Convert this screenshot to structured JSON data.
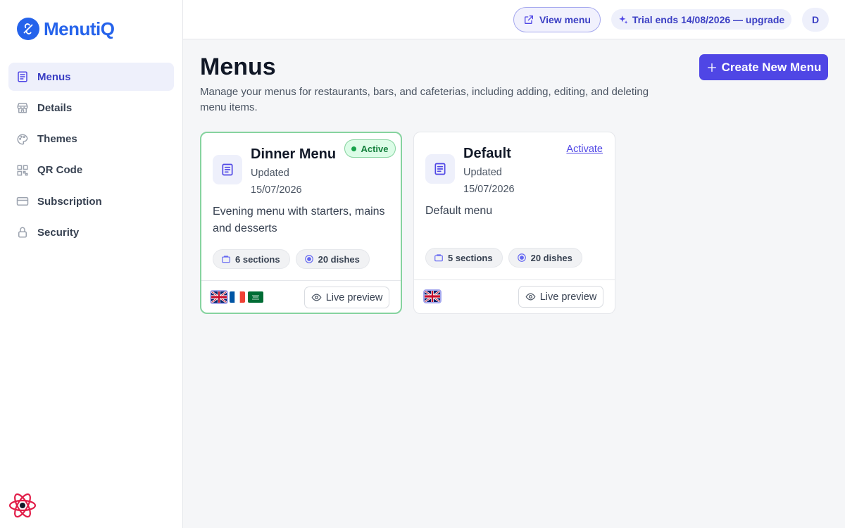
{
  "app": {
    "name": "MenutiQ"
  },
  "sidebar": {
    "items": [
      {
        "label": "Menus",
        "icon": "menu-list-icon",
        "active": true
      },
      {
        "label": "Details",
        "icon": "store-icon"
      },
      {
        "label": "Themes",
        "icon": "palette-icon"
      },
      {
        "label": "QR Code",
        "icon": "qr-code-icon"
      },
      {
        "label": "Subscription",
        "icon": "credit-card-icon"
      },
      {
        "label": "Security",
        "icon": "lock-icon"
      }
    ]
  },
  "topbar": {
    "view_menu_label": "View menu",
    "trial_label": "Trial ends 14/08/2026 — upgrade",
    "avatar_initial": "D"
  },
  "page": {
    "title": "Menus",
    "description": "Manage your menus for restaurants, bars, and cafeterias, including adding, editing, and deleting menu items.",
    "create_button_label": "Create New Menu"
  },
  "colors": {
    "accent": "#4f46e5",
    "brand": "#2563eb",
    "active_green": "#16a34a"
  },
  "menus": [
    {
      "title": "Dinner Menu",
      "updated_label": "Updated",
      "updated_date": "15/07/2026",
      "description": "Evening menu with starters, mains and desserts",
      "sections": "6 sections",
      "dishes": "20 dishes",
      "status": "Active",
      "languages": [
        "en",
        "fr",
        "ar"
      ],
      "preview_label": "Live preview"
    },
    {
      "title": "Default",
      "updated_label": "Updated",
      "updated_date": "15/07/2026",
      "description": "Default menu",
      "sections": "5 sections",
      "dishes": "20 dishes",
      "action": "Activate",
      "languages": [
        "en"
      ],
      "preview_label": "Live preview"
    }
  ]
}
